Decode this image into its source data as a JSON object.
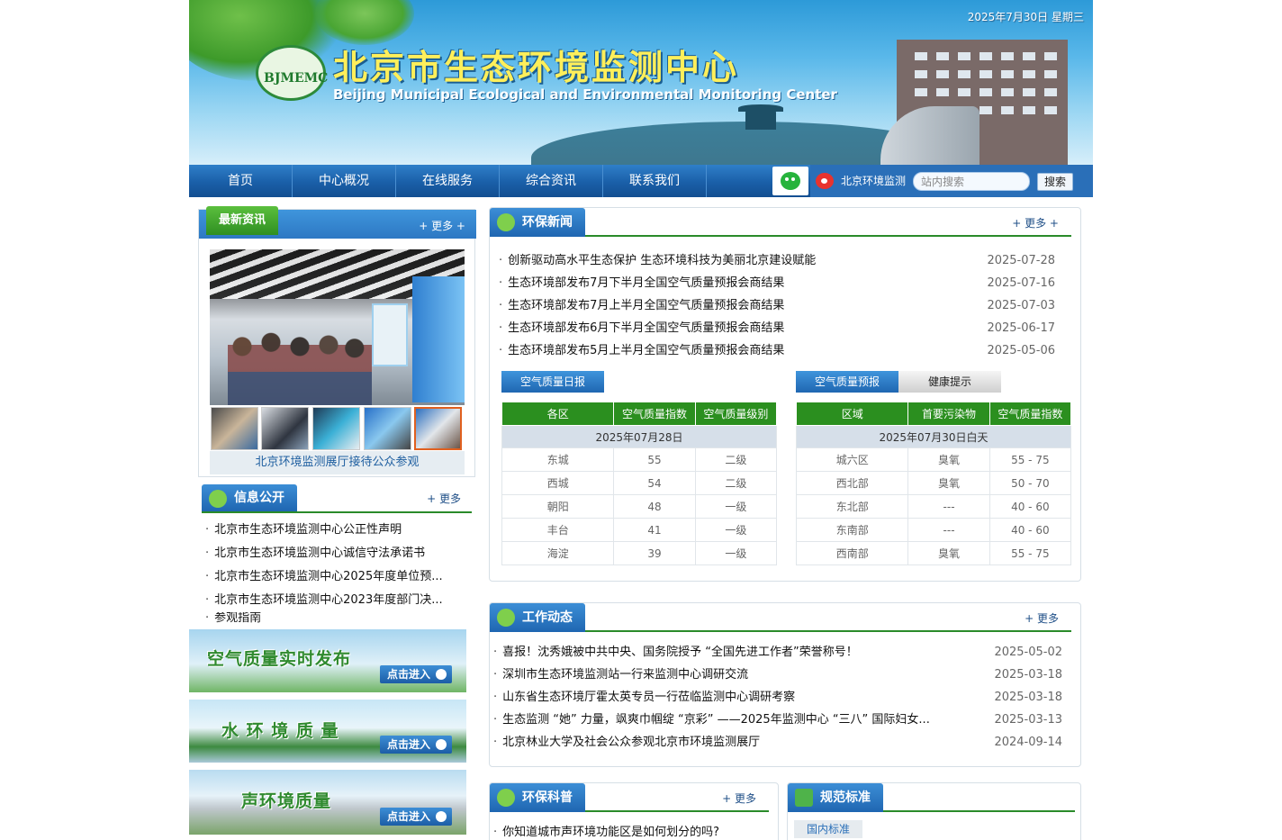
{
  "header": {
    "title_cn": "北京市生态环境监测中心",
    "title_en": "Beijing Municipal Ecological and Environmental Monitoring Center",
    "logo_text": "BJMEMC",
    "date": "2025年7月30日 星期三"
  },
  "nav": {
    "items": [
      "首页",
      "中心概况",
      "在线服务",
      "综合资讯",
      "联系我们"
    ],
    "weibo_label": "北京环境监测",
    "search_placeholder": "站内搜索",
    "search_button": "搜索"
  },
  "latest": {
    "tab": "最新资讯",
    "more": "+ 更多 +",
    "caption": "北京环境监测展厅接待公众参观"
  },
  "info": {
    "tab": "信息公开",
    "more": "+ 更多",
    "items": [
      "北京市生态环境监测中心公正性声明",
      "北京市生态环境监测中心诚信守法承诺书",
      "北京市生态环境监测中心2025年度单位预...",
      "北京市生态环境监测中心2023年度部门决...",
      "参观指南"
    ]
  },
  "banners": [
    {
      "title": "空气质量实时发布",
      "enter": "点击进入"
    },
    {
      "title": "水 环 境 质 量",
      "enter": "点击进入"
    },
    {
      "title": "声环境质量",
      "enter": "点击进入"
    }
  ],
  "env_news": {
    "tab": "环保新闻",
    "more": "+ 更多 +",
    "items": [
      {
        "title": "创新驱动高水平生态保护 生态环境科技为美丽北京建设赋能",
        "date": "2025-07-28"
      },
      {
        "title": "生态环境部发布7月下半月全国空气质量预报会商结果",
        "date": "2025-07-16"
      },
      {
        "title": "生态环境部发布7月上半月全国空气质量预报会商结果",
        "date": "2025-07-03"
      },
      {
        "title": "生态环境部发布6月下半月全国空气质量预报会商结果",
        "date": "2025-06-17"
      },
      {
        "title": "生态环境部发布5月上半月全国空气质量预报会商结果",
        "date": "2025-05-06"
      }
    ]
  },
  "aqi_daily": {
    "button": "空气质量日报",
    "headers": [
      "各区",
      "空气质量指数",
      "空气质量级别"
    ],
    "date": "2025年07月28日",
    "rows": [
      [
        "东城",
        "55",
        "二级"
      ],
      [
        "西城",
        "54",
        "二级"
      ],
      [
        "朝阳",
        "48",
        "一级"
      ],
      [
        "丰台",
        "41",
        "一级"
      ],
      [
        "海淀",
        "39",
        "一级"
      ]
    ]
  },
  "aqi_forecast": {
    "button": "空气质量预报",
    "button2": "健康提示",
    "headers": [
      "区域",
      "首要污染物",
      "空气质量指数"
    ],
    "date": "2025年07月30日白天",
    "rows": [
      [
        "城六区",
        "臭氧",
        "55 - 75"
      ],
      [
        "西北部",
        "臭氧",
        "50 - 70"
      ],
      [
        "东北部",
        "---",
        "40 - 60"
      ],
      [
        "东南部",
        "---",
        "40 - 60"
      ],
      [
        "西南部",
        "臭氧",
        "55 - 75"
      ]
    ]
  },
  "work": {
    "tab": "工作动态",
    "more": "+ 更多",
    "items": [
      {
        "title": "喜报！沈秀娥被中共中央、国务院授予 “全国先进工作者”荣誉称号！",
        "date": "2025-05-02"
      },
      {
        "title": "深圳市生态环境监测站一行来监测中心调研交流",
        "date": "2025-03-18"
      },
      {
        "title": "山东省生态环境厅霍太英专员一行莅临监测中心调研考察",
        "date": "2025-03-18"
      },
      {
        "title": "生态监测 “她” 力量，飒爽巾帼绽 “京彩” ——2025年监测中心 “三八” 国际妇女...",
        "date": "2025-03-13"
      },
      {
        "title": "北京林业大学及社会公众参观北京市环境监测展厅",
        "date": "2024-09-14"
      }
    ]
  },
  "science": {
    "tab": "环保科普",
    "more": "+ 更多",
    "items": [
      "你知道城市声环境功能区是如何划分的吗?"
    ]
  },
  "standards": {
    "tab": "规范标准",
    "sub_tab": "国内标准"
  }
}
